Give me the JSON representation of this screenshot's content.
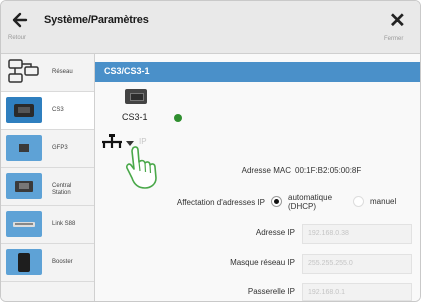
{
  "window": {
    "title": "Système/Paramètres",
    "back_label": "Retour",
    "close_label": "Fermer"
  },
  "sidebar": {
    "items": [
      {
        "label": "Réseau",
        "icon": "network-icon",
        "active": false
      },
      {
        "label": "CS3",
        "icon": "cs3-device-icon",
        "active": true
      },
      {
        "label": "GFP3",
        "icon": "gfp3-device-icon",
        "active": false
      },
      {
        "label": "Central Station",
        "icon": "central-station-icon",
        "active": false
      },
      {
        "label": "Link S88",
        "icon": "link-s88-icon",
        "active": false
      },
      {
        "label": "Booster",
        "icon": "booster-icon",
        "active": false
      }
    ]
  },
  "main": {
    "header": "CS3/CS3-1",
    "device_name": "CS3-1",
    "ip_faint": "IP",
    "mac_label": "Adresse MAC",
    "mac_value": "00:1F:B2:05:00:8F",
    "assign_label": "Affectation d'adresses IP",
    "assign_options": [
      "automatique (DHCP)",
      "manuel"
    ],
    "assign_selected": "automatique (DHCP)",
    "fields": [
      {
        "label": "Adresse IP",
        "value": "192.168.0.38"
      },
      {
        "label": "Masque réseau IP",
        "value": "255.255.255.0"
      },
      {
        "label": "Passerelle IP",
        "value": "192.168.0.1"
      }
    ]
  },
  "colors": {
    "accent": "#4a90c9",
    "sidebar_icon": "#5ea2d6",
    "active_icon": "#2f7fbf",
    "status_ok": "#2f8f2f"
  }
}
